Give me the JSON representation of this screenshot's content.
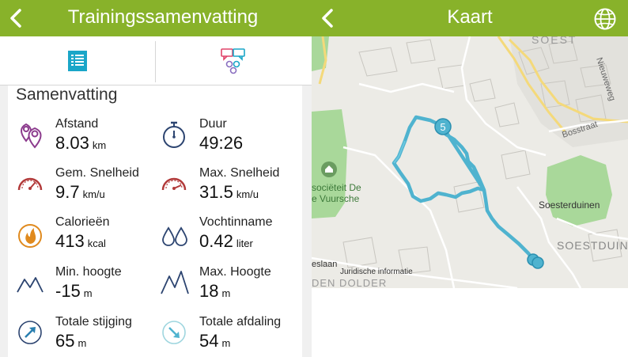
{
  "summary_screen": {
    "title": "Trainingssamenvatting",
    "tabs": [
      {
        "name": "summary-list",
        "icon": "list-icon",
        "color": "#1aa6c8"
      },
      {
        "name": "comments",
        "icon": "chat-bubbles-icon",
        "color": "#e0456a"
      }
    ],
    "section_title": "Samenvatting",
    "stats": [
      {
        "label": "Afstand",
        "value": "8.03",
        "unit": "km",
        "icon": "location-pins-icon"
      },
      {
        "label": "Duur",
        "value": "49:26",
        "unit": "",
        "icon": "stopwatch-icon"
      },
      {
        "label": "Gem. Snelheid",
        "value": "9.7",
        "unit": "km/u",
        "icon": "speedometer-icon"
      },
      {
        "label": "Max. Snelheid",
        "value": "31.5",
        "unit": "km/u",
        "icon": "speedometer-icon"
      },
      {
        "label": "Calorieën",
        "value": "413",
        "unit": "kcal",
        "icon": "flame-icon"
      },
      {
        "label": "Vochtinname",
        "value": "0.42",
        "unit": "liter",
        "icon": "water-drops-icon"
      },
      {
        "label": "Min. hoogte",
        "value": "-15",
        "unit": "m",
        "icon": "mountain-low-icon"
      },
      {
        "label": "Max. Hoogte",
        "value": "18",
        "unit": "m",
        "icon": "mountain-high-icon"
      },
      {
        "label": "Totale stijging",
        "value": "65",
        "unit": "m",
        "icon": "arrow-up-right-icon"
      },
      {
        "label": "Totale afdaling",
        "value": "54",
        "unit": "m",
        "icon": "arrow-down-right-icon"
      }
    ]
  },
  "map_screen": {
    "title": "Kaart",
    "labels": {
      "street_1": "Nieuweweg",
      "street_2": "Bosstraat",
      "area_1": "Soesterduinen",
      "area_2": "SOESTDUIN",
      "area_3": "SOEST",
      "poi": "sociëteit De",
      "poi_2": "e Vuursche",
      "street_3": "eslaan",
      "area_4": "DEN DOLDER"
    },
    "route_marker": "5",
    "legal_link": "Juridische informatie"
  },
  "colors": {
    "header": "#88b22a",
    "route": "#4fb3cf",
    "forest": "#a9d89a"
  }
}
